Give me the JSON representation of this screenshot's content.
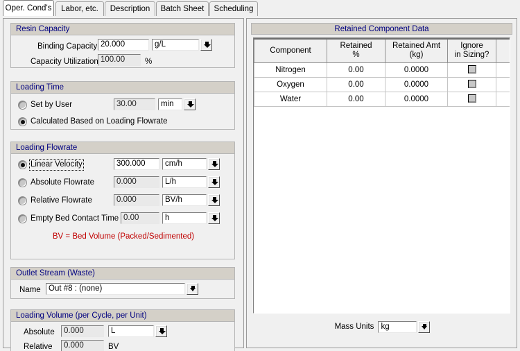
{
  "tabs": [
    {
      "label": "Oper. Cond's",
      "active": true
    },
    {
      "label": "Labor, etc.",
      "active": false
    },
    {
      "label": "Description",
      "active": false
    },
    {
      "label": "Batch Sheet",
      "active": false
    },
    {
      "label": "Scheduling",
      "active": false
    }
  ],
  "resin_capacity": {
    "title": "Resin Capacity",
    "binding_capacity_label": "Binding Capacity",
    "binding_capacity_value": "20.000",
    "binding_capacity_unit": "g/L",
    "capacity_utilization_label": "Capacity Utilization",
    "capacity_utilization_value": "100.00",
    "capacity_utilization_unit": "%"
  },
  "loading_time": {
    "title": "Loading Time",
    "set_by_user_label": "Set by User",
    "set_by_user_value": "30.00",
    "set_by_user_unit": "min",
    "calculated_label": "Calculated Based on Loading Flowrate",
    "selected": "calculated"
  },
  "loading_flowrate": {
    "title": "Loading Flowrate",
    "selected": "linear_velocity",
    "rows": [
      {
        "label": "Linear Velocity",
        "value": "300.000",
        "unit": "cm/h",
        "selected": true,
        "readonly": false
      },
      {
        "label": "Absolute Flowrate",
        "value": "0.000",
        "unit": "L/h",
        "selected": false,
        "readonly": true
      },
      {
        "label": "Relative Flowrate",
        "value": "0.000",
        "unit": "BV/h",
        "selected": false,
        "readonly": true
      },
      {
        "label": "Empty Bed Contact Time",
        "value": "0.00",
        "unit": "h",
        "selected": false,
        "readonly": true
      }
    ],
    "note": "BV = Bed Volume (Packed/Sedimented)"
  },
  "outlet_stream": {
    "title": "Outlet Stream (Waste)",
    "name_label": "Name",
    "name_value": "Out #8 : (none)"
  },
  "loading_volume": {
    "title": "Loading Volume (per Cycle, per Unit)",
    "absolute_label": "Absolute",
    "absolute_value": "0.000",
    "absolute_unit": "L",
    "relative_label": "Relative",
    "relative_value": "0.000",
    "relative_unit": "BV"
  },
  "retained": {
    "title": "Retained Component Data",
    "columns": [
      {
        "line1": "Component",
        "line2": ""
      },
      {
        "line1": "Retained",
        "line2": "%"
      },
      {
        "line1": "Retained Amt",
        "line2": "(kg)"
      },
      {
        "line1": "Ignore",
        "line2": "in Sizing?"
      },
      {
        "line1": "",
        "line2": ""
      }
    ],
    "rows": [
      {
        "component": "Nitrogen",
        "retained_pct": "0.00",
        "retained_amt": "0.0000",
        "ignore": false
      },
      {
        "component": "Oxygen",
        "retained_pct": "0.00",
        "retained_amt": "0.0000",
        "ignore": false
      },
      {
        "component": "Water",
        "retained_pct": "0.00",
        "retained_amt": "0.0000",
        "ignore": false
      }
    ],
    "mass_units_label": "Mass Units",
    "mass_units_value": "kg"
  },
  "colors": {
    "group_header_text": "#000080",
    "note_text": "#c00000",
    "group_header_bg": "#d4d0c8",
    "window_bg": "#f0f0f0"
  }
}
